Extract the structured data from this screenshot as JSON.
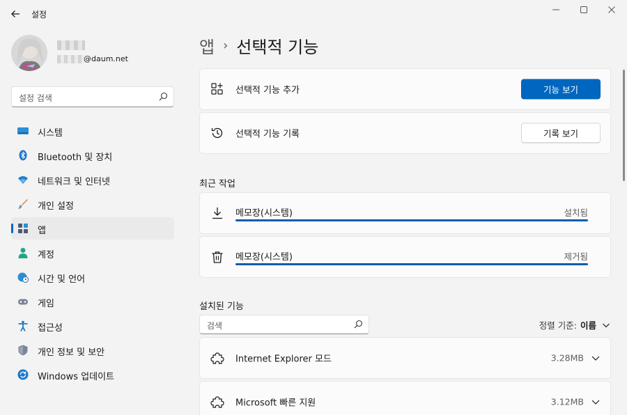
{
  "window": {
    "title": "설정"
  },
  "profile": {
    "email_suffix": "@daum.net"
  },
  "sidebar": {
    "search_placeholder": "설정 검색",
    "items": [
      {
        "label": "시스템",
        "icon": "system-icon"
      },
      {
        "label": "Bluetooth 및 장치",
        "icon": "bluetooth-icon"
      },
      {
        "label": "네트워크 및 인터넷",
        "icon": "wifi-icon"
      },
      {
        "label": "개인 설정",
        "icon": "brush-icon"
      },
      {
        "label": "앱",
        "icon": "apps-icon",
        "active": true
      },
      {
        "label": "계정",
        "icon": "account-icon"
      },
      {
        "label": "시간 및 언어",
        "icon": "globe-clock-icon"
      },
      {
        "label": "게임",
        "icon": "gamepad-icon"
      },
      {
        "label": "접근성",
        "icon": "accessibility-icon"
      },
      {
        "label": "개인 정보 및 보안",
        "icon": "shield-icon"
      },
      {
        "label": "Windows 업데이트",
        "icon": "update-icon"
      }
    ]
  },
  "breadcrumb": {
    "parent": "앱",
    "separator": "›",
    "current": "선택적 기능"
  },
  "cards": {
    "add": {
      "label": "선택적 기능 추가",
      "button": "기능 보기"
    },
    "history": {
      "label": "선택적 기능 기록",
      "button": "기록 보기"
    }
  },
  "recent": {
    "title": "최근 작업",
    "tasks": [
      {
        "name": "메모장(시스템)",
        "status": "설치됨",
        "progress": 1.0,
        "icon": "download-icon"
      },
      {
        "name": "메모장(시스템)",
        "status": "제거됨",
        "progress": 1.0,
        "icon": "trash-icon"
      }
    ]
  },
  "installed": {
    "title": "설치된 기능",
    "search_placeholder": "검색",
    "sort_label": "정렬 기준:",
    "sort_value": "이름",
    "features": [
      {
        "name": "Internet Explorer 모드",
        "size": "3.28MB"
      },
      {
        "name": "Microsoft 빠른 지원",
        "size": "3.12MB"
      }
    ]
  },
  "colors": {
    "accent": "#0067c0",
    "progress": "#0b5cad",
    "background": "#f3f3f3",
    "card": "#fbfbfb"
  }
}
